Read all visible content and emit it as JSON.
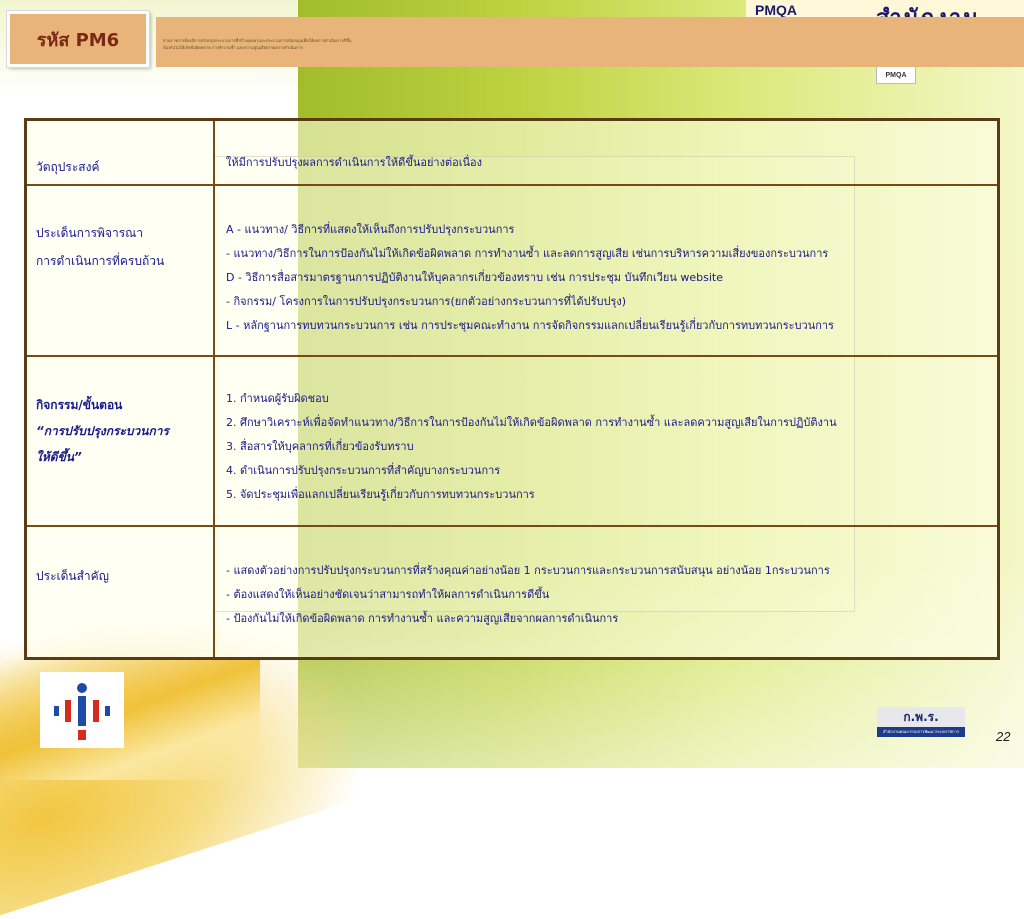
{
  "header": {
    "code": "รหัส PM6",
    "subtitle_line1": "ส่วนราชการต้องมีการปรับปรุงกระบวนการที่สร้างคุณค่าและกระบวนการสนับสนุนเพื่อให้ผลการดำเนินการดีขึ้น",
    "subtitle_line2": "ป้องกันไม่ให้เกิดข้อผิดพลาด การทำงานซ้ำ และความสูญเสียจากผลการดำเนินการ"
  },
  "brand": {
    "pmqa_label": "PMQA",
    "logo_glyphs": "สำนักงาน",
    "emblem_text": "PMQA"
  },
  "table": {
    "rows": [
      {
        "label_lines": [
          "วัตถุประสงค์"
        ],
        "content_lines": [
          "ให้มีการปรับปรุงผลการดำเนินการให้ดีขึ้นอย่างต่อเนื่อง"
        ]
      },
      {
        "label_lines": [
          "ประเด็นการพิจารณา",
          "การดำเนินการที่ครบถ้วน"
        ],
        "content_lines": [
          "A   - แนวทาง/ วิธีการที่แสดงให้เห็นถึงการปรับปรุงกระบวนการ",
          "      - แนวทาง/วิธีการในการป้องกันไม่ให้เกิดข้อผิดพลาด การทำงานซ้ำ และลดการสูญเสีย เช่นการบริหารความเสี่ยงของกระบวนการ",
          "D  - วิธีการสื่อสารมาตรฐานการปฏิบัติงานให้บุคลากรเกี่ยวข้องทราบ เช่น การประชุม บันทึกเวียน website",
          "      - กิจกรรม/ โครงการในการปรับปรุงกระบวนการ(ยกตัวอย่างกระบวนการที่ได้ปรับปรุง)",
          "L     - หลักฐานการทบทวนกระบวนการ เช่น การประชุมคณะทำงาน การจัดกิจกรรมแลกเปลี่ยนเรียนรู้เกี่ยวกับการทบทวนกระบวนการ"
        ]
      },
      {
        "label_lines": [
          "กิจกรรม/ขั้นตอน",
          "“การปรับปรุงกระบวนการ",
          "ให้ดีขึ้น”"
        ],
        "content_lines": [
          "1. กำหนดผู้รับผิดชอบ",
          "2. ศึกษาวิเคราะห์เพื่อจัดทำแนวทาง/วิธีการในการป้องกันไม่ให้เกิดข้อผิดพลาด การทำงานซ้ำ และลดความสูญเสียในการปฏิบัติงาน",
          "3. สื่อสารให้บุคลากรที่เกี่ยวข้องรับทราบ",
          "4. ดำเนินการปรับปรุงกระบวนการที่สำคัญบางกระบวนการ",
          "5. จัดประชุมเพื่อแลกเปลี่ยนเรียนรู้เกี่ยวกับการทบทวนกระบวนการ"
        ]
      },
      {
        "label_lines": [
          "ประเด็นสำคัญ"
        ],
        "content_lines": [
          "-  แสดงตัวอย่างการปรับปรุงกระบวนการที่สร้างคุณค่าอย่างน้อย 1 กระบวนการและกระบวนการสนับสนุน อย่างน้อย 1กระบวนการ",
          "- ต้องแสดงให้เห็นอย่างชัดเจนว่าสามารถทำให้ผลการดำเนินการดีขึ้น",
          "- ป้องกันไม่ให้เกิดข้อผิดพลาด การทำงานซ้ำ และความสูญเสียจากผลการดำเนินการ"
        ]
      }
    ]
  },
  "footer": {
    "ocsc_name": "ก.พ.ร.",
    "ocsc_subtitle": "สำนักงานคณะกรรมการพัฒนาระบบราชการ",
    "page_number": "22"
  },
  "colors": {
    "header_fill": "#e8b47a",
    "code_text": "#7a2a14",
    "table_border": "#5b3a14",
    "table_text": "#1a1a8a",
    "background_green": "#bcd23f"
  }
}
